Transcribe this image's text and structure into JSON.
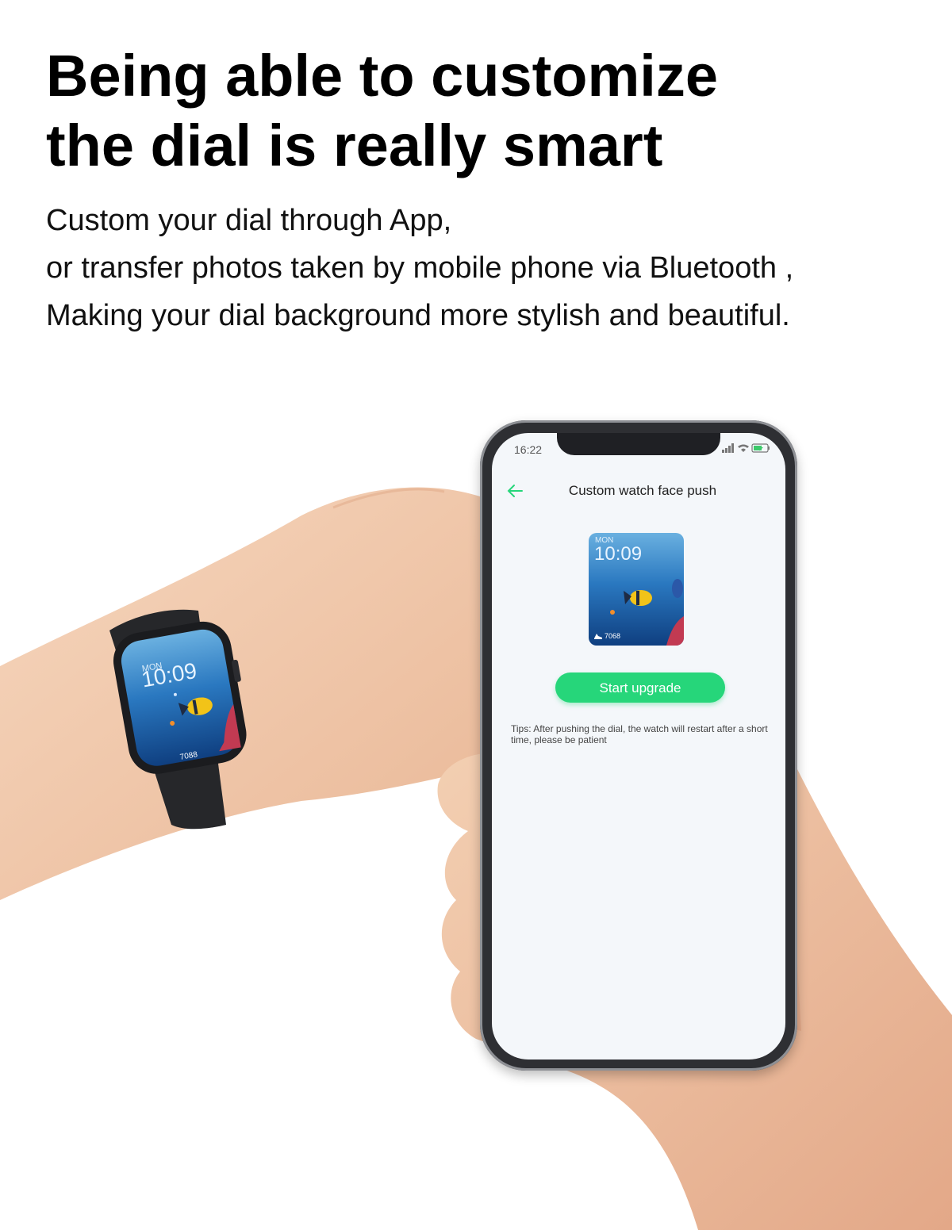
{
  "headline": {
    "line1": "Being able to customize",
    "line2": "the dial is really smart"
  },
  "subtext": {
    "line1": "Custom your dial through App,",
    "line2": "or transfer photos taken by mobile phone via Bluetooth ,",
    "line3": "Making your dial background more stylish and beautiful."
  },
  "phone": {
    "status_time": "16:22",
    "status_icons": [
      "signal-icon",
      "wifi-icon",
      "battery-charging-icon"
    ],
    "back_icon": "back-arrow-icon",
    "title": "Custom watch face push",
    "preview": {
      "day": "MON",
      "time": "10:09",
      "steps": "7068"
    },
    "upgrade_button": "Start upgrade",
    "tips": "Tips: After pushing the dial, the watch will restart after a short time, please be patient"
  },
  "watch": {
    "day": "MON",
    "time": "10:09",
    "steps": "7088"
  },
  "colors": {
    "accent_green": "#26d67a",
    "skin": "#f0c8aa",
    "ocean_blue": "#1f6fb5"
  }
}
